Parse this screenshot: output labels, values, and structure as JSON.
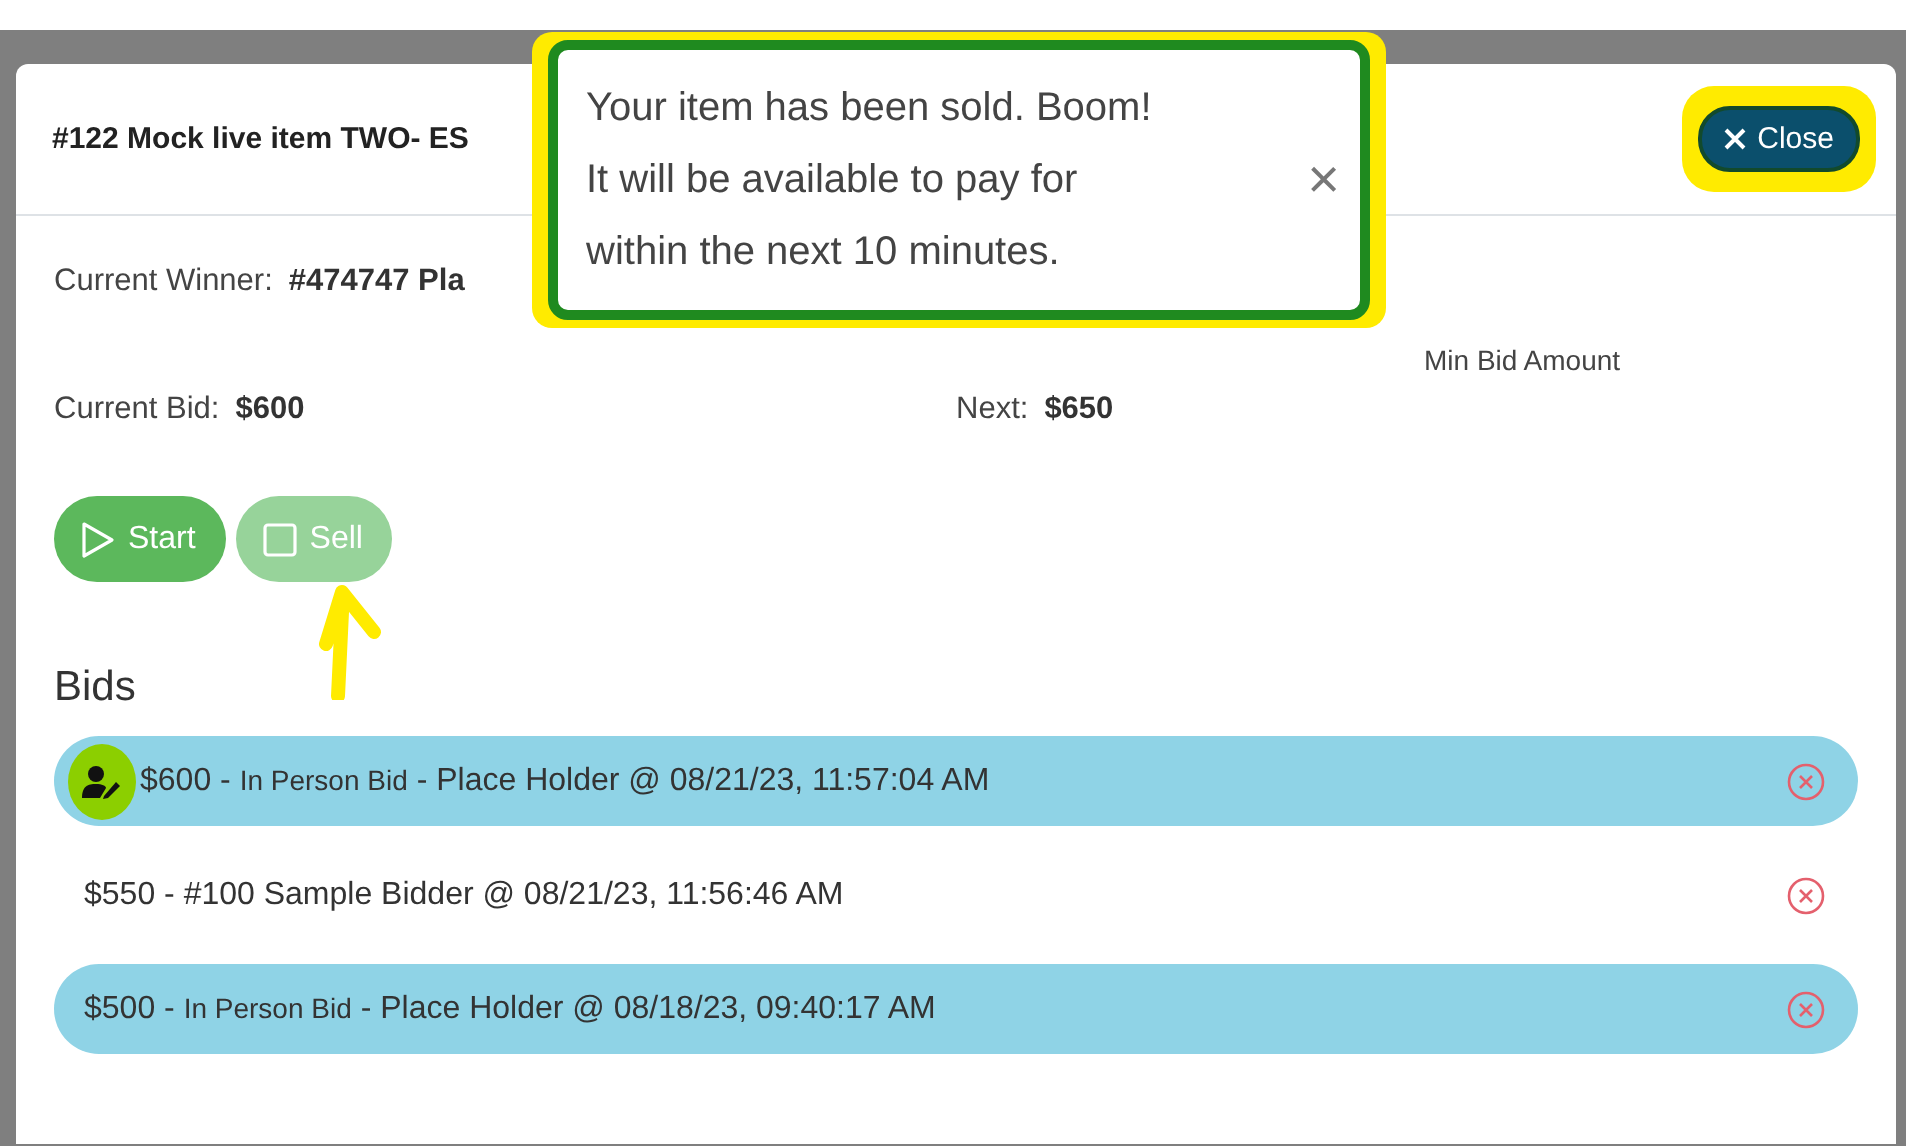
{
  "modal": {
    "title": "#122 Mock live item TWO- ES",
    "close_label": "Close"
  },
  "toast": {
    "message": [
      "Your item has been sold. Boom!",
      "It will be available to pay for",
      "within the next 10 minutes."
    ],
    "close_glyph": "×"
  },
  "current_winner": {
    "label": "Current Winner:",
    "value": "#474747 Pla"
  },
  "current_bid": {
    "label": "Current Bid:",
    "value": "$600"
  },
  "next_bid": {
    "caption": "Min Bid Amount",
    "label": "Next:",
    "value": "$650"
  },
  "buttons": [
    {
      "kind": "start",
      "label": "Start",
      "disabled": false
    },
    {
      "kind": "sell",
      "label": "Sell",
      "disabled": true
    }
  ],
  "bids_heading": "Bids",
  "bids": [
    {
      "amount": "$600 -",
      "source": "In Person Bid",
      "detail": "- Place Holder @ 08/21/23, 11:57:04 AM",
      "highlighted": true,
      "editor_icon": true
    },
    {
      "amount": "$550 -",
      "detail": "#100 Sample Bidder @ 08/21/23, 11:56:46 AM",
      "highlighted": false,
      "editor_icon": false
    },
    {
      "amount": "$500 -",
      "source": "In Person Bid",
      "detail": "- Place Holder @ 08/18/23, 09:40:17 AM",
      "highlighted": true,
      "editor_icon": false
    }
  ]
}
